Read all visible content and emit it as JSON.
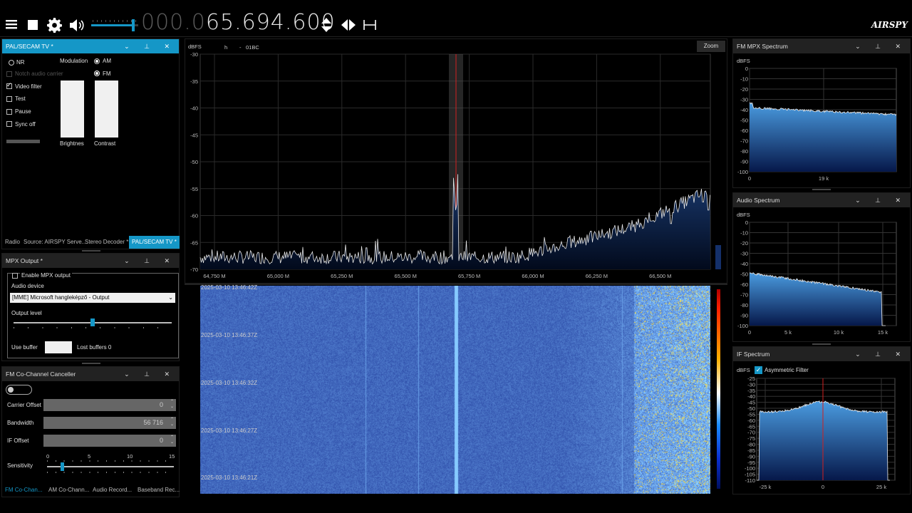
{
  "toolbar": {
    "freq_dim": "000.0",
    "freq_lit": "65.694.600",
    "logo": "AIRSPY",
    "icons": [
      "menu-icon",
      "stop-icon",
      "gear-icon",
      "speaker-icon",
      "updown-arrows-icon",
      "left-right-arrows-icon",
      "span-icon"
    ],
    "volume_level": 0.9
  },
  "pal_panel": {
    "title": "PAL/SECAM TV *",
    "nr": "NR",
    "notch": "Notch audio carrier",
    "video_filter": "Video filter",
    "test": "Test",
    "pause": "Pause",
    "sync_off": "Sync off",
    "modulation": "Modulation",
    "am": "AM",
    "fm": "FM",
    "brightness": "Brightnes",
    "contrast": "Contrast"
  },
  "left_tabs": [
    "Radio",
    "Source: AIRSPY Serve...",
    "Stereo Decoder *",
    "PAL/SECAM TV *"
  ],
  "mpx_panel": {
    "title": "MPX Output *",
    "enable": "Enable MPX output",
    "audio_device": "Audio device",
    "device_value": "[MME] Microsoft hangleképző - Output",
    "output_level": "Output level",
    "output_level_value": 0.5,
    "use_buffer": "Use buffer",
    "lost_buffers": "Lost buffers 0"
  },
  "cochannel": {
    "title": "FM Co-Channel Canceller",
    "carrier_offset": "Carrier Offset",
    "carrier_value": "0",
    "bandwidth": "Bandwidth",
    "bandwidth_value": "56 716",
    "if_offset": "IF Offset",
    "if_value": "0",
    "sensitivity": "Sensitivity",
    "sens_ticks": [
      "0",
      "5",
      "10",
      "15"
    ],
    "sensitivity_value": 1.8
  },
  "bottom_tabs": [
    "FM Co-Chan...",
    "AM Co-Chann...",
    "Audio Record...",
    "Baseband Rec..."
  ],
  "spectrum": {
    "ylabel": "dBFS",
    "marker_h": "h",
    "marker_dash": "-",
    "marker_code": "01BC",
    "zoom": "Zoom",
    "side_value": "8",
    "yticks": [
      "-30",
      "-35",
      "-40",
      "-45",
      "-50",
      "-55",
      "-60",
      "-65",
      "-70"
    ],
    "xticks": [
      "64,750 M",
      "65,000 M",
      "65,250 M",
      "65,500 M",
      "65,750 M",
      "66,000 M",
      "66,250 M",
      "66,500 M"
    ]
  },
  "waterfall": {
    "timestamps": [
      "2025-03-10 13:46:42Z",
      "2025-03-10 13:46:37Z",
      "2025-03-10 13:46:32Z",
      "2025-03-10 13:46:27Z",
      "2025-03-10 13:46:21Z"
    ]
  },
  "mpx_spec": {
    "title": "FM MPX Spectrum",
    "ylabel": "dBFS",
    "yticks": [
      "0",
      "-10",
      "-20",
      "-30",
      "-40",
      "-50",
      "-60",
      "-70",
      "-80",
      "-90",
      "-100"
    ],
    "xticks": [
      "0",
      "19 k"
    ]
  },
  "audio_spec": {
    "title": "Audio Spectrum",
    "ylabel": "dBFS",
    "yticks": [
      "0",
      "-10",
      "-20",
      "-30",
      "-40",
      "-50",
      "-60",
      "-70",
      "-80",
      "-90",
      "-100"
    ],
    "xticks": [
      "0",
      "5 k",
      "10 k",
      "15 k"
    ]
  },
  "if_spec": {
    "title": "IF Spectrum",
    "ylabel": "dBFS",
    "asym": "Asymmetric Filter",
    "yticks": [
      "-25",
      "-30",
      "-35",
      "-40",
      "-45",
      "-50",
      "-55",
      "-60",
      "-65",
      "-70",
      "-75",
      "-80",
      "-85",
      "-90",
      "-95",
      "-100",
      "-105",
      "-110"
    ],
    "xticks": [
      "-25 k",
      "0",
      "25 k"
    ]
  },
  "colors": {
    "accent": "#1597c7",
    "header": "#222222",
    "trace": "#e8e8e8",
    "fill_top": "#2b5d96",
    "fill_bot": "#04122a"
  }
}
